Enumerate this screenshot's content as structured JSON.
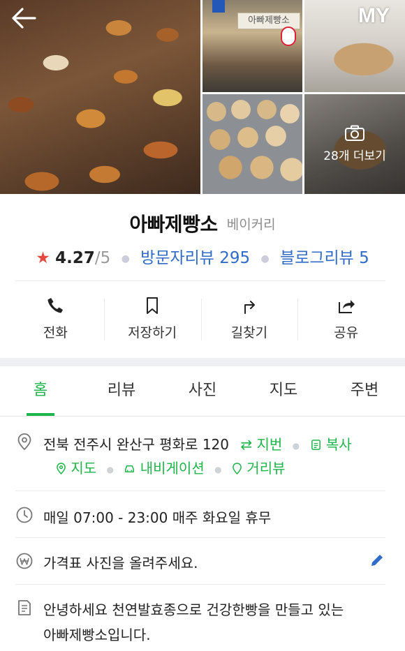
{
  "header": {
    "back_icon": "back-arrow-icon",
    "my_label": "MY",
    "more_photos_label": "28개 더보기",
    "camera_icon": "camera-icon",
    "storefront_sign": "아빠제빵소"
  },
  "place": {
    "name": "아빠제빵소",
    "category": "베이커리",
    "rating_star": "★",
    "rating": "4.27",
    "rating_max": "/5",
    "visitor_reviews": "방문자리뷰 295",
    "blog_reviews": "블로그리뷰 5"
  },
  "actions": [
    {
      "label": "전화",
      "icon": "phone-icon"
    },
    {
      "label": "저장하기",
      "icon": "bookmark-icon"
    },
    {
      "label": "길찾기",
      "icon": "directions-icon"
    },
    {
      "label": "공유",
      "icon": "share-icon"
    }
  ],
  "tabs": [
    {
      "label": "홈",
      "active": true
    },
    {
      "label": "리뷰",
      "active": false
    },
    {
      "label": "사진",
      "active": false
    },
    {
      "label": "지도",
      "active": false
    },
    {
      "label": "주변",
      "active": false
    }
  ],
  "address": {
    "text": "전북 전주시 완산구 평화로 120",
    "lot_label": "지번",
    "copy_label": "복사",
    "map_label": "지도",
    "navigation_label": "내비게이션",
    "street_view_label": "거리뷰"
  },
  "hours": {
    "text": "매일 07:00 - 23:00 매주 화요일 휴무"
  },
  "price": {
    "placeholder": "가격표 사진을 올려주세요."
  },
  "description": {
    "line1": "안녕하세요 천연발효종으로 건강한빵을 만들고 있는",
    "line2": "아빠제빵소입니다."
  },
  "colors": {
    "accent_green": "#1eb54a",
    "link_blue": "#2f6bc7",
    "star_red": "#e5483e"
  }
}
